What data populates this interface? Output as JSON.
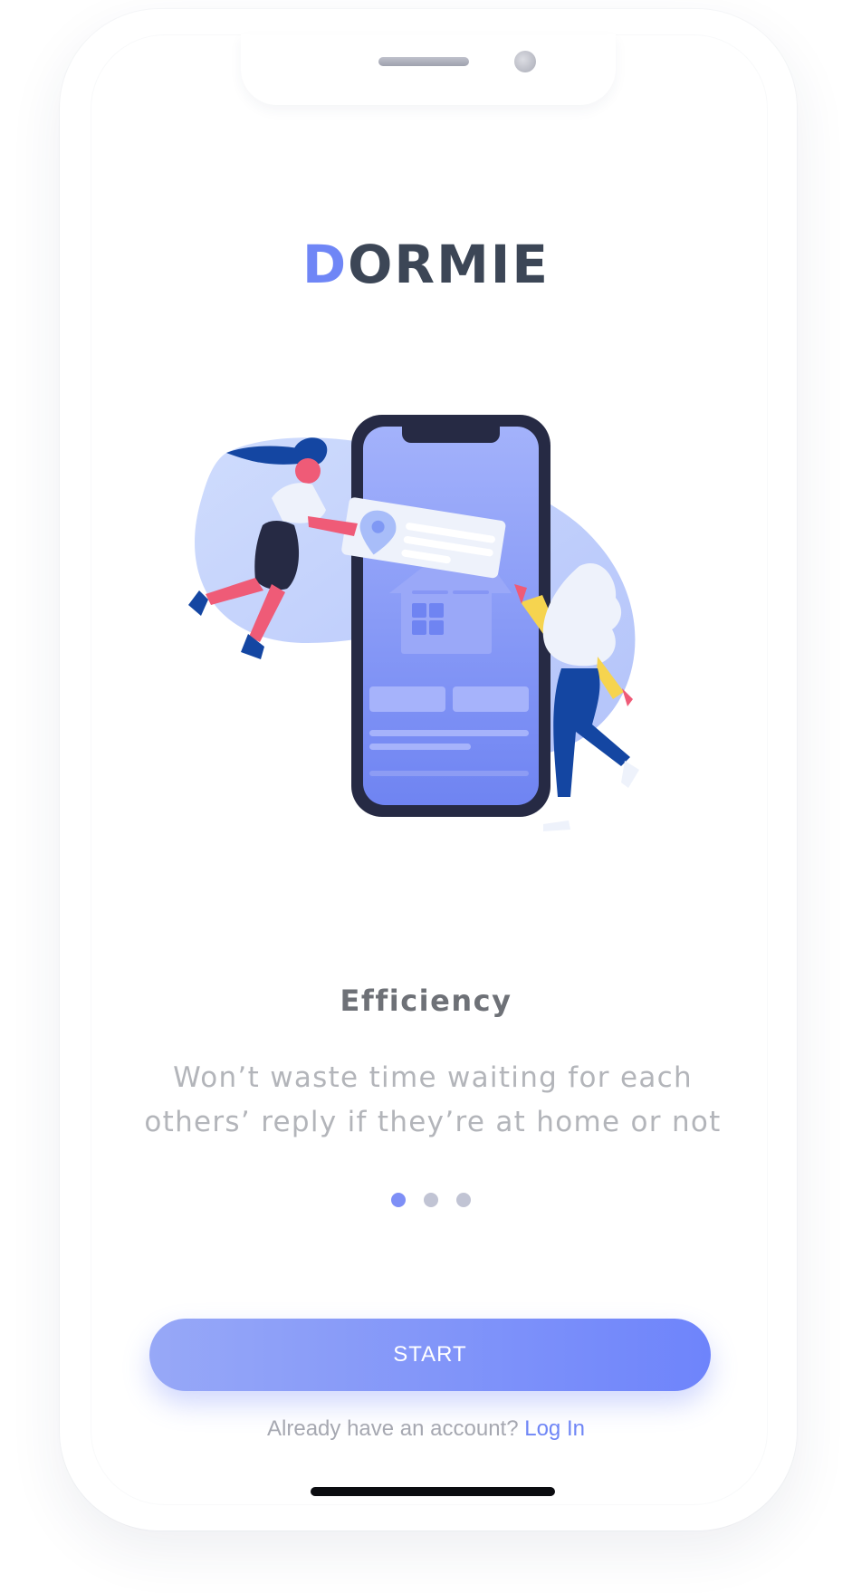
{
  "app": {
    "logo_first_letter": "D",
    "logo_rest": "ORMIE"
  },
  "onboarding": {
    "title": "Efficiency",
    "description_line1": "Won’t waste time waiting for each",
    "description_line2": "others’ reply if they’re at home or not",
    "page_count": 3,
    "active_page": 1
  },
  "actions": {
    "start_label": "START",
    "login_prompt": "Already have an account?",
    "login_link": "Log In"
  },
  "colors": {
    "accent": "#6f86f6",
    "button_gradient_start": "#97a8f7",
    "button_gradient_end": "#6e84fb",
    "text_dark": "#3c4656",
    "text_muted": "#b3b5ba"
  },
  "icons": [
    "location-pin-icon",
    "house-icon"
  ]
}
